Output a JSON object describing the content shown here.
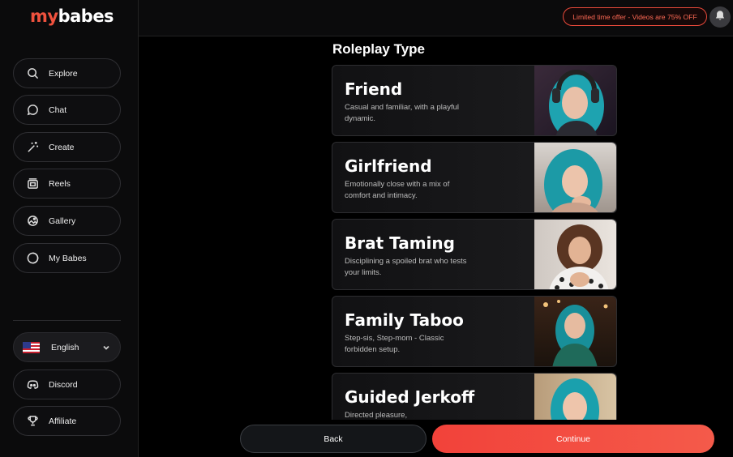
{
  "brand": {
    "part1": "my",
    "part2": "babes"
  },
  "sidebar": {
    "items": [
      {
        "label": "Explore",
        "icon": "search-icon"
      },
      {
        "label": "Chat",
        "icon": "chat-icon"
      },
      {
        "label": "Create",
        "icon": "magic-wand-icon"
      },
      {
        "label": "Reels",
        "icon": "reels-icon"
      },
      {
        "label": "Gallery",
        "icon": "gallery-icon"
      },
      {
        "label": "My Babes",
        "icon": "heart-icon"
      }
    ],
    "language": {
      "label": "English",
      "flag": "us-flag-icon"
    },
    "bottom_items": [
      {
        "label": "Discord",
        "icon": "discord-icon"
      },
      {
        "label": "Affiliate",
        "icon": "trophy-icon"
      }
    ]
  },
  "topbar": {
    "offer_text": "Limited time offer - Videos are 75% OFF",
    "bell_icon": "bell-icon"
  },
  "main": {
    "title": "Roleplay Type",
    "cards": [
      {
        "title": "Friend",
        "description": "Casual and familiar, with a playful dynamic."
      },
      {
        "title": "Girlfriend",
        "description": "Emotionally close with a mix of comfort and intimacy."
      },
      {
        "title": "Brat Taming",
        "description": "Disciplining a spoiled brat who tests your limits."
      },
      {
        "title": "Family Taboo",
        "description": "Step-sis, Step-mom - Classic forbidden setup."
      },
      {
        "title": "Guided Jerkoff",
        "description": "Directed pleasure,"
      }
    ]
  },
  "footer": {
    "back_label": "Back",
    "continue_label": "Continue"
  },
  "colors": {
    "accent": "#f2423a",
    "background": "#000000",
    "offer_border": "#e8493a"
  }
}
